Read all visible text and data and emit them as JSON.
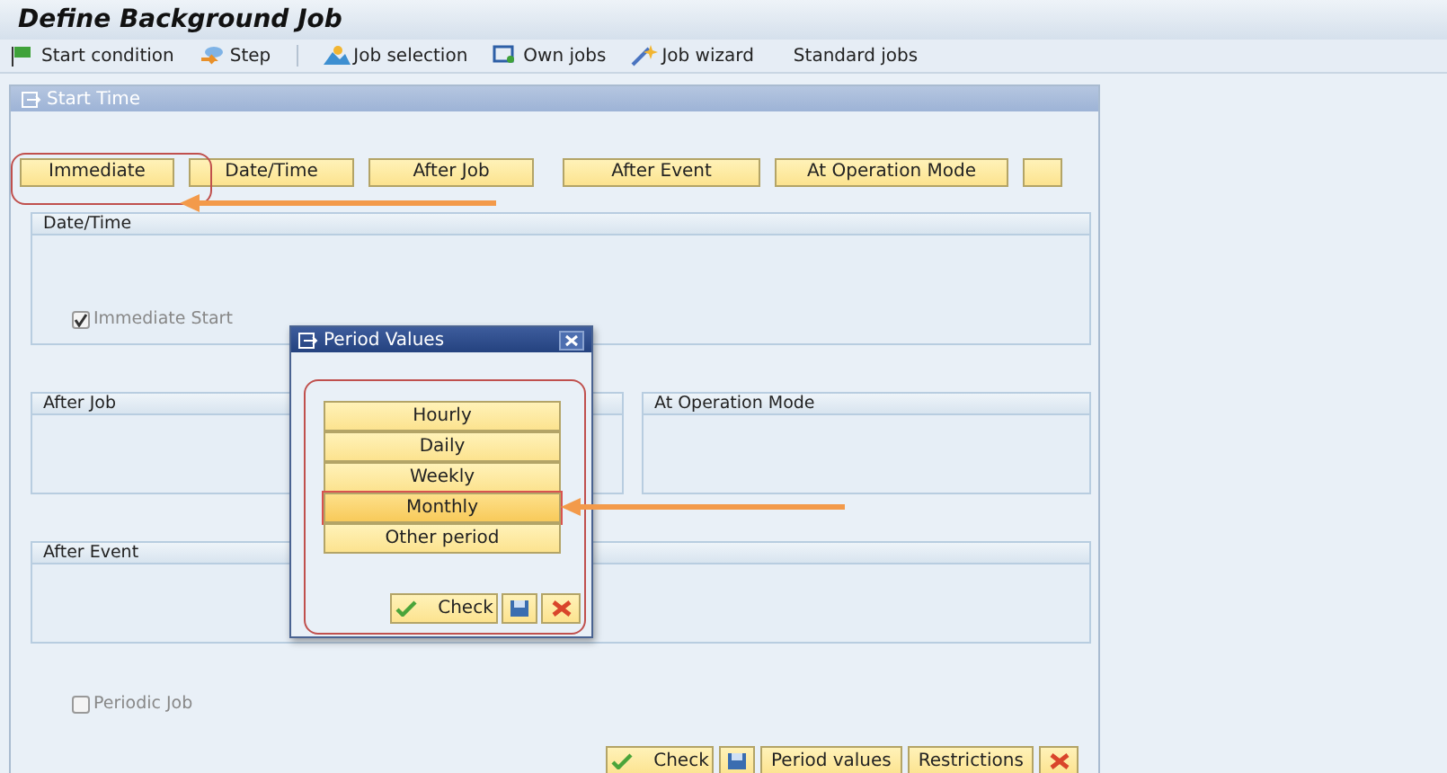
{
  "window": {
    "title": "Define Background Job"
  },
  "toolbar": [
    {
      "label": "Start condition",
      "kind": "flag"
    },
    {
      "label": "Step",
      "kind": "step"
    },
    {
      "label": "Job selection",
      "kind": "jobs"
    },
    {
      "label": "Own jobs",
      "kind": "own"
    },
    {
      "label": "Job wizard",
      "kind": "wizard"
    },
    {
      "label": "Standard jobs",
      "kind": "plain"
    }
  ],
  "panel": {
    "title": "Start Time",
    "start_buttons": [
      {
        "label": "Immediate"
      },
      {
        "label": "Date/Time"
      },
      {
        "label": "After Job"
      },
      {
        "label": "After Event"
      },
      {
        "label": "At Operation Mode"
      }
    ],
    "groups": [
      {
        "title": "Date/Time",
        "checkbox": {
          "label": "Immediate Start",
          "checked": true
        }
      },
      {
        "title": "After Job"
      },
      {
        "title": "At Operation Mode"
      },
      {
        "title": "After Event"
      }
    ],
    "periodic": {
      "label": "Periodic Job",
      "checked": false
    },
    "buttons": [
      {
        "kind": "check",
        "label": "Check"
      },
      {
        "kind": "save"
      },
      {
        "kind": "text",
        "label": "Period values"
      },
      {
        "kind": "text",
        "label": "Restrictions"
      },
      {
        "kind": "cancel"
      }
    ]
  },
  "dialog": {
    "title": "Period Values",
    "options": [
      {
        "label": "Hourly",
        "selected": false
      },
      {
        "label": "Daily",
        "selected": false
      },
      {
        "label": "Weekly",
        "selected": false
      },
      {
        "label": "Monthly",
        "selected": true
      },
      {
        "label": "Other period",
        "selected": false
      }
    ],
    "buttons": [
      {
        "kind": "check",
        "label": "Check"
      },
      {
        "kind": "save"
      },
      {
        "kind": "cancel"
      }
    ]
  }
}
